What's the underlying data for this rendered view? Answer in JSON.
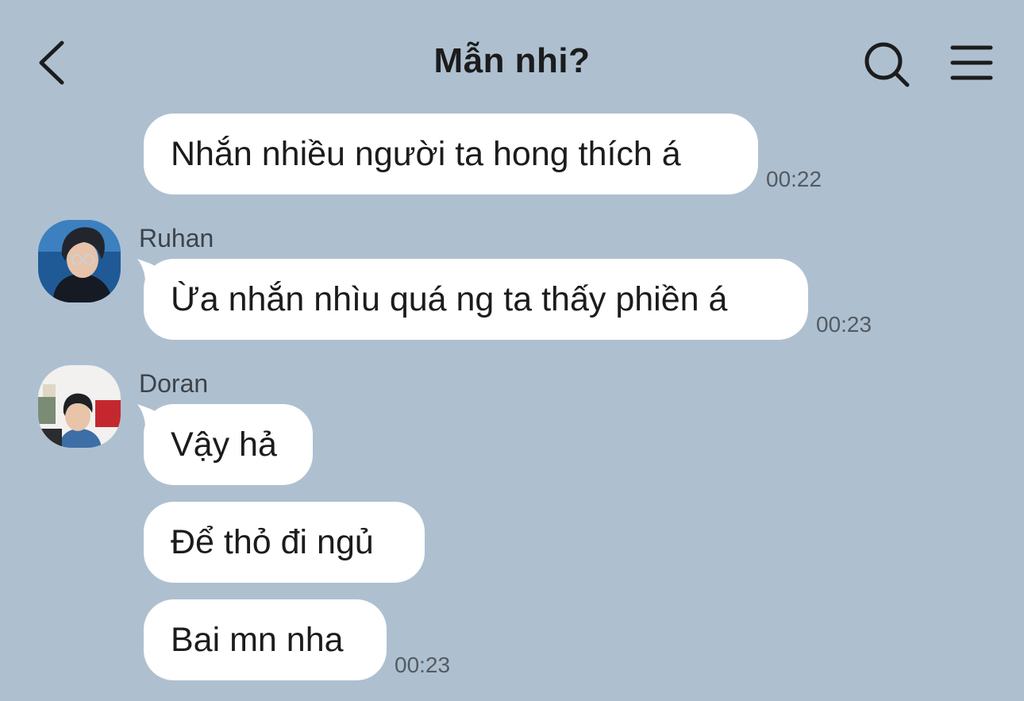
{
  "header": {
    "title": "Mẫn nhi?",
    "back_icon": "chevron-left-icon",
    "search_icon": "search-icon",
    "menu_icon": "hamburger-menu-icon"
  },
  "messages": [
    {
      "text": "Nhắn nhiều người ta hong thích á",
      "time": "00:22"
    },
    {
      "sender": "Ruhan",
      "text": "Ừa nhắn nhìu quá ng ta thấy phiền á",
      "time": "00:23"
    },
    {
      "sender": "Doran",
      "text": "Vậy hả"
    },
    {
      "text": "Để thỏ đi ngủ"
    },
    {
      "text": "Bai mn nha",
      "time": "00:23"
    }
  ],
  "colors": {
    "background": "#aec0d0",
    "bubble": "#ffffff",
    "text": "#1c1c1c",
    "time": "#535b63"
  }
}
